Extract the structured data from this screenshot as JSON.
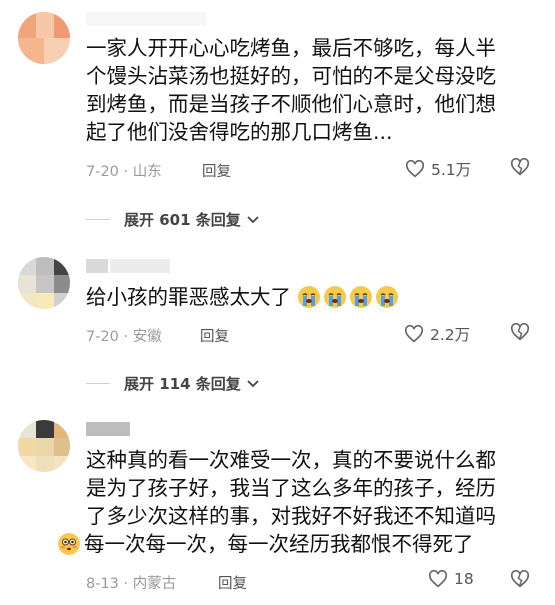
{
  "comments": [
    {
      "text_lines": [
        "一家人开开心心吃烤鱼，最后不够吃，每人半",
        "个馒头沾菜汤也挺好的，可怕的不是父母没吃",
        "到烤鱼，而是当孩子不顺他们心意时，他们想",
        "起了他们没舍得吃的那几口烤鱼..."
      ],
      "meta": "7-20 · 山东",
      "reply_label": "回复",
      "likes": "5.1万",
      "expand_label": "展开 601 条回复"
    },
    {
      "text": "给小孩的罪恶感太大了",
      "meta": "7-20 · 安徽",
      "reply_label": "回复",
      "likes": "2.2万",
      "expand_label": "展开 114 条回复"
    },
    {
      "text_lines": [
        "这种真的看一次难受一次，真的不要说什么都",
        "是为了孩子好，我当了这么多年的孩子，经历",
        "了多少次这样的事，对我好不好我还不知道吗",
        "每一次每一次，每一次经历我都恨不得死了"
      ],
      "meta": "8-13 · 内蒙古",
      "reply_label": "回复",
      "likes": "18"
    }
  ],
  "icons": {
    "like": "heart-outline-icon",
    "dislike": "broken-heart-icon",
    "expand": "chevron-down-icon",
    "crying_emoji": "loudly-crying-face-emoji",
    "flushed_emoji": "flushed-face-emoji"
  },
  "colors": {
    "meta_text": "#9a9a9a",
    "body_text": "#111111",
    "action_text": "#555555"
  }
}
